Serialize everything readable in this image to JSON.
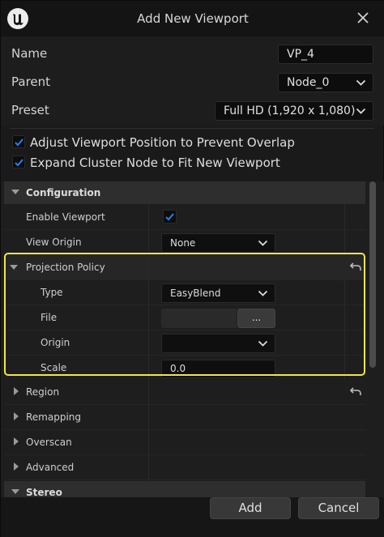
{
  "window": {
    "title": "Add New Viewport",
    "logo_icon": "unreal-logo-icon",
    "close_icon": "close-icon"
  },
  "form": {
    "name_label": "Name",
    "name_value": "VP_4",
    "parent_label": "Parent",
    "parent_value": "Node_0",
    "preset_label": "Preset",
    "preset_value": "Full HD (1,920 x 1,080)"
  },
  "options": [
    {
      "label": "Adjust Viewport Position to Prevent Overlap",
      "checked": true
    },
    {
      "label": "Expand Cluster Node to Fit New Viewport",
      "checked": true
    }
  ],
  "details": {
    "configuration": {
      "label": "Configuration",
      "enable_viewport_label": "Enable Viewport",
      "enable_viewport_checked": true,
      "view_origin_label": "View Origin",
      "view_origin_value": "None"
    },
    "projection_policy": {
      "label": "Projection Policy",
      "type_label": "Type",
      "type_value": "EasyBlend",
      "file_label": "File",
      "file_value": "",
      "file_browse_label": "...",
      "origin_label": "Origin",
      "origin_value": "",
      "scale_label": "Scale",
      "scale_value": "0.0"
    },
    "collapsed_sections": [
      "Region",
      "Remapping",
      "Overscan",
      "Advanced"
    ],
    "stereo_label": "Stereo"
  },
  "footer": {
    "add_label": "Add",
    "cancel_label": "Cancel"
  },
  "colors": {
    "accent_check": "#1f6fe0",
    "highlight": "#f0e54a"
  }
}
